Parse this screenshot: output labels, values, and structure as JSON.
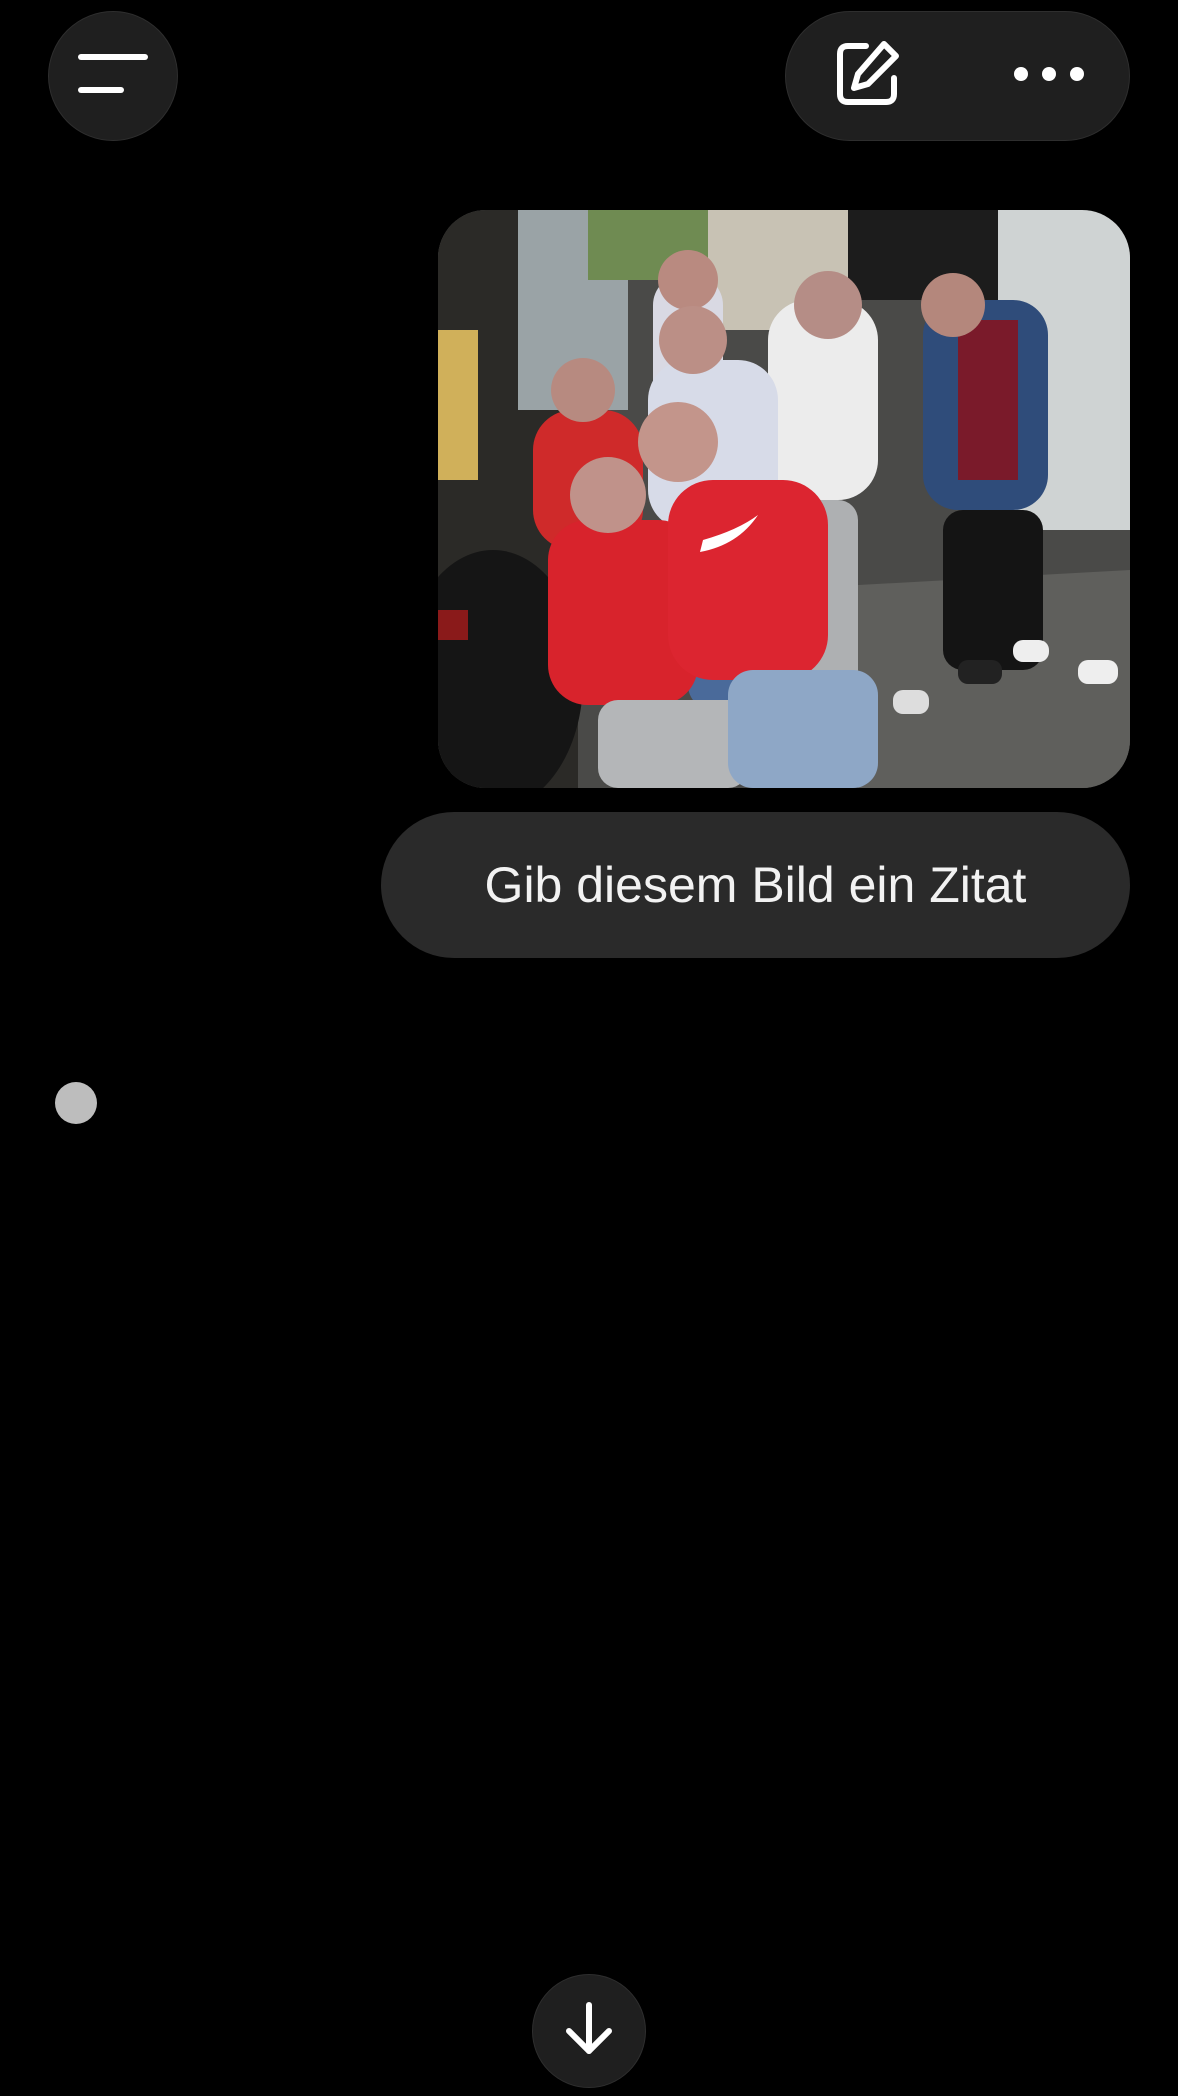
{
  "header": {
    "menu_icon": "hamburger-menu-icon",
    "edit_icon": "new-chat-edit-icon",
    "more_icon": "more-options-icon"
  },
  "conversation": {
    "user_image": "photo of a group of people making peace signs outside a shop",
    "user_message": "Gib diesem Bild ein Zitat",
    "assistant_status": "typing-indicator"
  },
  "footer": {
    "scroll_icon": "arrow-down-icon"
  },
  "colors": {
    "background": "#000000",
    "button_surface": "#1f1f1f",
    "bubble_surface": "#2a2a2a",
    "text": "#f2f2f2",
    "typing_dot": "#bdbdbd"
  }
}
